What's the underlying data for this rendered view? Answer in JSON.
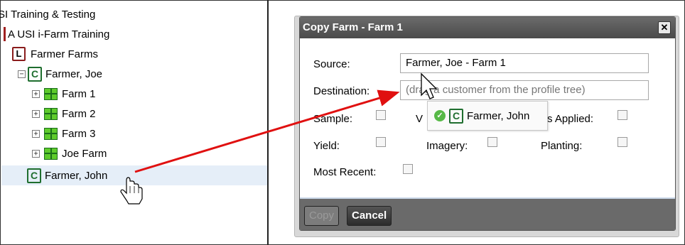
{
  "tree": {
    "items": [
      {
        "label": "SI Training & Testing"
      },
      {
        "label": "A USI i-Farm Training"
      },
      {
        "label": "Farmer Farms"
      },
      {
        "label": "Farmer, Joe"
      },
      {
        "label": "Farm 1"
      },
      {
        "label": "Farm 2"
      },
      {
        "label": "Farm 3"
      },
      {
        "label": "Joe Farm"
      },
      {
        "label": "Farmer, John"
      }
    ],
    "collapse_glyph": "−",
    "expand_glyph": "+",
    "customer_badge": "C",
    "list_badge": "L"
  },
  "dialog": {
    "title": "Copy Farm - Farm 1",
    "close_glyph": "✕",
    "source_label": "Source:",
    "source_value": "Farmer, Joe - Farm 1",
    "destination_label": "Destination:",
    "destination_placeholder": "(drag a customer from the profile tree)",
    "options": {
      "sample": "Sample:",
      "applied_partial": "s Applied:",
      "hidden_partial": "V",
      "yield": "Yield:",
      "imagery": "Imagery:",
      "planting": "Planting:",
      "most_recent": "Most Recent:"
    },
    "buttons": {
      "copy": "Copy",
      "cancel": "Cancel"
    }
  },
  "drag_ghost": {
    "label": "Farmer, John",
    "status_glyph": "✓",
    "badge": "C"
  },
  "colors": {
    "titlebar": "#555555",
    "customer_green": "#1f6e2f",
    "farm_green": "#5ecb2c",
    "arrow_red": "#e01010",
    "selected_row": "#e5eef8"
  },
  "icons": {
    "hand_cursor": "hand-pointer-icon",
    "arrow_cursor": "arrow-pointer-icon"
  }
}
